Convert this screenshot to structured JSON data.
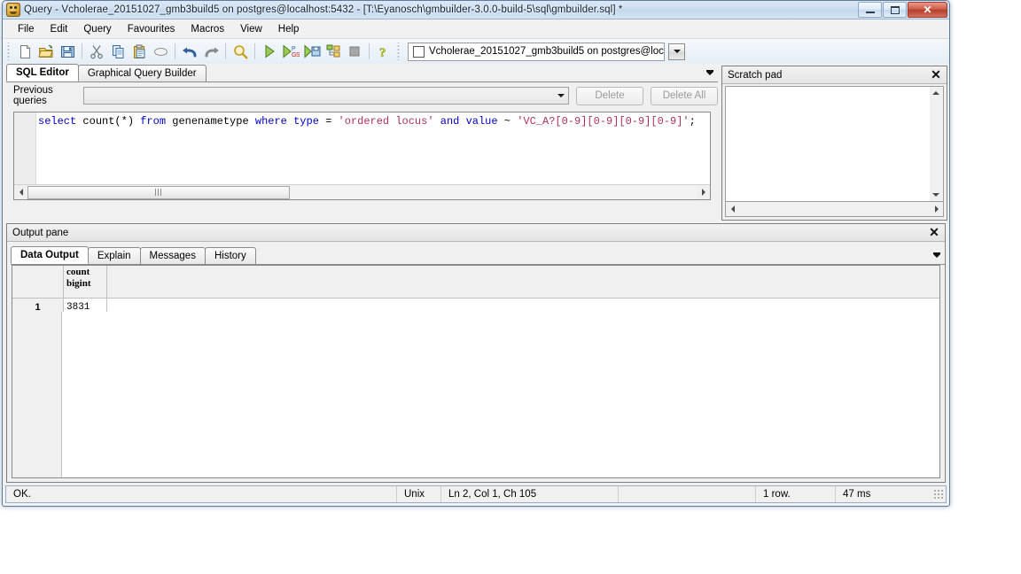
{
  "window": {
    "title": "Query - Vcholerae_20151027_gmb3build5 on postgres@localhost:5432 - [T:\\Eyanosch\\gmbuilder-3.0.0-build-5\\sql\\gmbuilder.sql] *",
    "app_icon": "elephant-icon",
    "buttons": {
      "minimize": "minimize-icon",
      "maximize": "maximize-icon",
      "close": "✕"
    }
  },
  "menubar": {
    "items": [
      {
        "label": "File"
      },
      {
        "label": "Edit"
      },
      {
        "label": "Query"
      },
      {
        "label": "Favourites"
      },
      {
        "label": "Macros"
      },
      {
        "label": "View"
      },
      {
        "label": "Help"
      }
    ]
  },
  "toolbar": {
    "buttons": [
      {
        "name": "new-file-icon",
        "glyph": "page"
      },
      {
        "name": "open-file-icon",
        "glyph": "folder"
      },
      {
        "name": "save-file-icon",
        "glyph": "floppy"
      },
      {
        "name": "cut-icon",
        "glyph": "scissors"
      },
      {
        "name": "copy-icon",
        "glyph": "copy"
      },
      {
        "name": "paste-icon",
        "glyph": "clipboard"
      },
      {
        "name": "clear-icon",
        "glyph": "eraser"
      },
      {
        "name": "undo-icon",
        "glyph": "undo"
      },
      {
        "name": "redo-icon",
        "glyph": "redo"
      },
      {
        "name": "find-icon",
        "glyph": "magnifier"
      },
      {
        "name": "execute-query-icon",
        "glyph": "play"
      },
      {
        "name": "explain-query-icon",
        "glyph": "play-pgs"
      },
      {
        "name": "execute-to-file-icon",
        "glyph": "play-save"
      },
      {
        "name": "explain-analyze-icon",
        "glyph": "tree"
      },
      {
        "name": "cancel-query-icon",
        "glyph": "stop"
      },
      {
        "name": "help-icon",
        "glyph": "question"
      }
    ],
    "database_combo": {
      "value": "Vcholerae_20151027_gmb3build5 on postgres@localh",
      "checkbox_checked": false
    }
  },
  "query_panel": {
    "tabs": [
      {
        "label": "SQL Editor",
        "active": true
      },
      {
        "label": "Graphical Query Builder",
        "active": false
      }
    ],
    "collapse_icon": "collapse-arrow-icon",
    "previous_queries": {
      "label": "Previous queries",
      "value": "",
      "delete_label": "Delete",
      "delete_all_label": "Delete All"
    },
    "sql": {
      "tokens": [
        {
          "t": "select",
          "c": "kw"
        },
        {
          "t": " count(*) ",
          "c": "op"
        },
        {
          "t": "from",
          "c": "kw"
        },
        {
          "t": " genenametype ",
          "c": "op"
        },
        {
          "t": "where",
          "c": "kw"
        },
        {
          "t": " ",
          "c": "op"
        },
        {
          "t": "type",
          "c": "kw"
        },
        {
          "t": " = ",
          "c": "op"
        },
        {
          "t": "'ordered locus'",
          "c": "str"
        },
        {
          "t": " ",
          "c": "op"
        },
        {
          "t": "and",
          "c": "kw"
        },
        {
          "t": " ",
          "c": "op"
        },
        {
          "t": "value",
          "c": "kw"
        },
        {
          "t": " ~ ",
          "c": "op"
        },
        {
          "t": "'VC_A?[0-9][0-9][0-9][0-9]'",
          "c": "str"
        },
        {
          "t": ";",
          "c": "op"
        }
      ],
      "plain": "select count(*) from genenametype where type = 'ordered locus' and value ~ 'VC_A?[0-9][0-9][0-9][0-9]';"
    }
  },
  "scratch_pad": {
    "title": "Scratch pad",
    "close_icon": "✕",
    "content": ""
  },
  "output_pane": {
    "title": "Output pane",
    "close_icon": "✕",
    "collapse_icon": "collapse-arrow-icon",
    "tabs": [
      {
        "label": "Data Output",
        "active": true
      },
      {
        "label": "Explain",
        "active": false
      },
      {
        "label": "Messages",
        "active": false
      },
      {
        "label": "History",
        "active": false
      }
    ],
    "grid": {
      "columns": [
        {
          "name": "count",
          "type": "bigint"
        }
      ],
      "rows": [
        {
          "num": "1",
          "values": [
            "3831"
          ]
        }
      ]
    }
  },
  "statusbar": {
    "message": "OK.",
    "line_ending": "Unix",
    "cursor": "Ln 2, Col 1, Ch 105",
    "rows": "1 row.",
    "duration": "47 ms"
  }
}
